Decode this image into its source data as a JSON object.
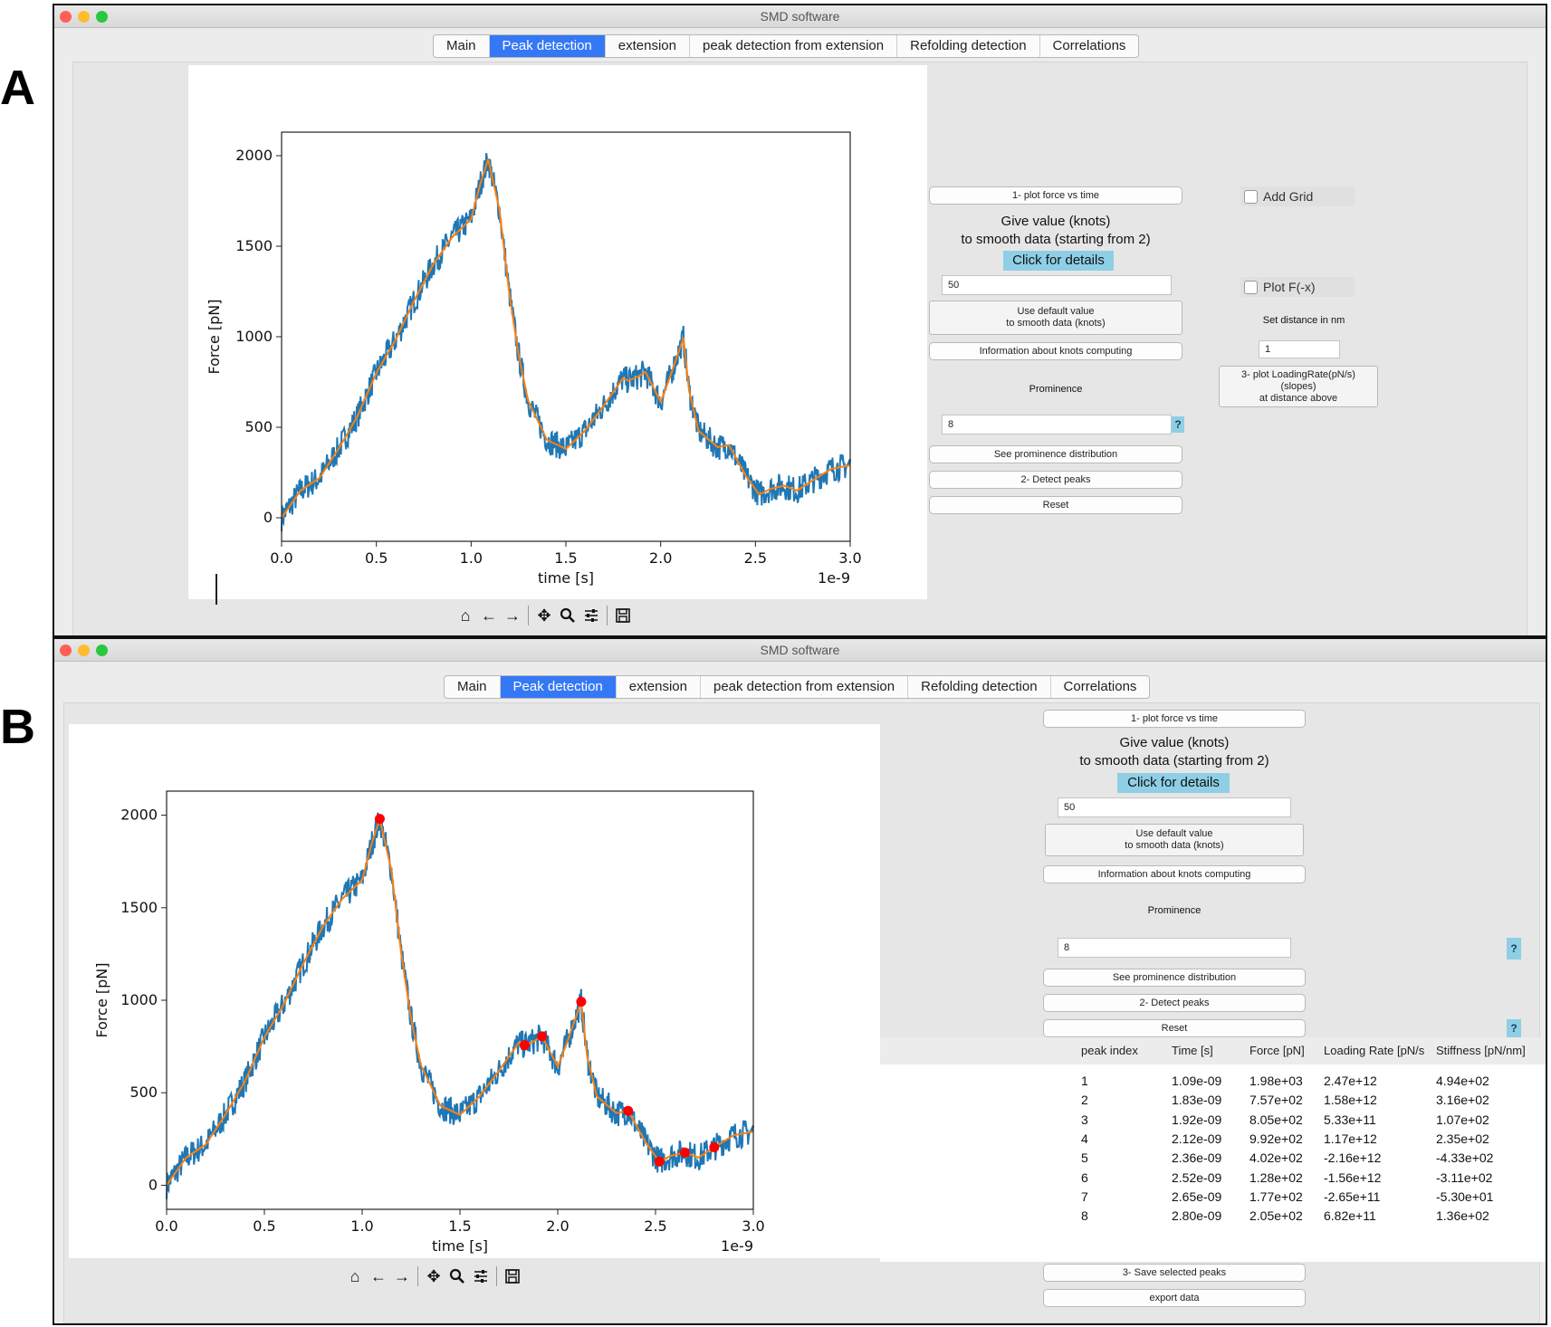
{
  "panels": [
    "A",
    "B"
  ],
  "window": {
    "title": "SMD software"
  },
  "tabs": [
    "Main",
    "Peak detection",
    "extension",
    "peak detection from extension",
    "Refolding detection",
    "Correlations"
  ],
  "controls": {
    "plot_force_btn": "1- plot force vs time",
    "smooth_prompt_1": "Give value (knots)",
    "smooth_prompt_2": "to smooth data (starting from 2)",
    "details_btn": "Click for details",
    "knots_value": "50",
    "default_btn_1": "Use default value",
    "default_btn_2": "to smooth data (knots)",
    "info_btn": "Information about knots computing",
    "prominence_label": "Prominence",
    "prominence_value": "8",
    "help_btn": "?",
    "prominence_dist_btn": "See prominence distribution",
    "detect_btn": "2- Detect peaks",
    "reset_btn": "Reset",
    "add_grid": "Add Grid",
    "plot_fx": "Plot F(-x)",
    "distance_label": "Set distance in nm",
    "distance_value": "1",
    "loading_btn_1": "3- plot LoadingRate(pN/s)",
    "loading_btn_2": "(slopes)",
    "loading_btn_3": "at distance above",
    "save_btn": "3- Save selected peaks",
    "export_btn": "export data"
  },
  "toolbar_icons": [
    "home-icon",
    "back-arrow-icon",
    "forward-arrow-icon",
    "pan-icon",
    "zoom-icon",
    "subplots-icon",
    "save-icon"
  ],
  "chart_data": [
    {
      "type": "line",
      "xlabel": "time [s]",
      "ylabel": "Force [pN]",
      "x_offset_label": "1e-9",
      "xlim": [
        0.0,
        3.0
      ],
      "ylim": [
        -130,
        2130
      ],
      "xticks": [
        "0.0",
        "0.5",
        "1.0",
        "1.5",
        "2.0",
        "2.5",
        "3.0"
      ],
      "yticks": [
        "0",
        "500",
        "1000",
        "1500",
        "2000"
      ],
      "series": [
        {
          "color": "#1f77b4",
          "x": [
            0.0,
            0.1,
            0.2,
            0.3,
            0.4,
            0.5,
            0.6,
            0.7,
            0.8,
            0.9,
            1.0,
            1.05,
            1.09,
            1.15,
            1.2,
            1.25,
            1.3,
            1.4,
            1.5,
            1.6,
            1.7,
            1.8,
            1.83,
            1.88,
            1.92,
            2.0,
            2.05,
            2.12,
            2.15,
            2.2,
            2.3,
            2.36,
            2.45,
            2.52,
            2.58,
            2.65,
            2.72,
            2.8,
            2.9,
            3.0
          ],
          "y": [
            0,
            150,
            220,
            380,
            560,
            800,
            980,
            1200,
            1400,
            1550,
            1650,
            1850,
            1980,
            1700,
            1250,
            900,
            650,
            430,
            380,
            480,
            620,
            770,
            757,
            780,
            805,
            640,
            780,
            992,
            700,
            480,
            390,
            402,
            230,
            128,
            160,
            177,
            150,
            205,
            270,
            290
          ]
        },
        {
          "color": "#ff7f0e",
          "x": [
            0.0,
            0.1,
            0.2,
            0.3,
            0.4,
            0.5,
            0.6,
            0.7,
            0.8,
            0.9,
            1.0,
            1.05,
            1.09,
            1.15,
            1.2,
            1.25,
            1.3,
            1.4,
            1.5,
            1.6,
            1.7,
            1.8,
            1.83,
            1.88,
            1.92,
            2.0,
            2.05,
            2.12,
            2.15,
            2.2,
            2.3,
            2.36,
            2.45,
            2.52,
            2.58,
            2.65,
            2.72,
            2.8,
            2.9,
            3.0
          ],
          "y": [
            0,
            150,
            220,
            380,
            560,
            800,
            980,
            1200,
            1400,
            1550,
            1650,
            1850,
            1980,
            1700,
            1250,
            900,
            650,
            430,
            380,
            480,
            620,
            770,
            757,
            780,
            805,
            640,
            780,
            992,
            700,
            480,
            390,
            402,
            230,
            128,
            160,
            177,
            150,
            205,
            270,
            290
          ]
        }
      ]
    },
    {
      "type": "line",
      "xlabel": "time [s]",
      "ylabel": "Force [pN]",
      "x_offset_label": "1e-9",
      "xlim": [
        0.0,
        3.0
      ],
      "ylim": [
        -130,
        2130
      ],
      "xticks": [
        "0.0",
        "0.5",
        "1.0",
        "1.5",
        "2.0",
        "2.5",
        "3.0"
      ],
      "yticks": [
        "0",
        "500",
        "1000",
        "1500",
        "2000"
      ],
      "series": [
        {
          "color": "#1f77b4",
          "x": [
            0.0,
            0.1,
            0.2,
            0.3,
            0.4,
            0.5,
            0.6,
            0.7,
            0.8,
            0.9,
            1.0,
            1.05,
            1.09,
            1.15,
            1.2,
            1.25,
            1.3,
            1.4,
            1.5,
            1.6,
            1.7,
            1.8,
            1.83,
            1.88,
            1.92,
            2.0,
            2.05,
            2.12,
            2.15,
            2.2,
            2.3,
            2.36,
            2.45,
            2.52,
            2.58,
            2.65,
            2.72,
            2.8,
            2.9,
            3.0
          ],
          "y": [
            0,
            150,
            220,
            380,
            560,
            800,
            980,
            1200,
            1400,
            1550,
            1650,
            1850,
            1980,
            1700,
            1250,
            900,
            650,
            430,
            380,
            480,
            620,
            770,
            757,
            780,
            805,
            640,
            780,
            992,
            700,
            480,
            390,
            402,
            230,
            128,
            160,
            177,
            150,
            205,
            270,
            290
          ]
        },
        {
          "color": "#ff7f0e",
          "x": [
            0.0,
            0.1,
            0.2,
            0.3,
            0.4,
            0.5,
            0.6,
            0.7,
            0.8,
            0.9,
            1.0,
            1.05,
            1.09,
            1.15,
            1.2,
            1.25,
            1.3,
            1.4,
            1.5,
            1.6,
            1.7,
            1.8,
            1.83,
            1.88,
            1.92,
            2.0,
            2.05,
            2.12,
            2.15,
            2.2,
            2.3,
            2.36,
            2.45,
            2.52,
            2.58,
            2.65,
            2.72,
            2.8,
            2.9,
            3.0
          ],
          "y": [
            0,
            150,
            220,
            380,
            560,
            800,
            980,
            1200,
            1400,
            1550,
            1650,
            1850,
            1980,
            1700,
            1250,
            900,
            650,
            430,
            380,
            480,
            620,
            770,
            757,
            780,
            805,
            640,
            780,
            992,
            700,
            480,
            390,
            402,
            230,
            128,
            160,
            177,
            150,
            205,
            270,
            290
          ]
        }
      ],
      "peaks": {
        "color": "#ff0000",
        "x": [
          1.09,
          1.83,
          1.92,
          2.12,
          2.36,
          2.52,
          2.65,
          2.8
        ],
        "y": [
          1980,
          757,
          805,
          992,
          402,
          128,
          177,
          205
        ]
      }
    }
  ],
  "table": {
    "headers": [
      "peak index",
      "Time [s]",
      "Force [pN]",
      "Loading Rate [pN/s",
      "Stiffness [pN/nm]"
    ],
    "rows": [
      [
        "1",
        "1.09e-09",
        "1.98e+03",
        "2.47e+12",
        "4.94e+02"
      ],
      [
        "2",
        "1.83e-09",
        "7.57e+02",
        "1.58e+12",
        "3.16e+02"
      ],
      [
        "3",
        "1.92e-09",
        "8.05e+02",
        "5.33e+11",
        "1.07e+02"
      ],
      [
        "4",
        "2.12e-09",
        "9.92e+02",
        "1.17e+12",
        "2.35e+02"
      ],
      [
        "5",
        "2.36e-09",
        "4.02e+02",
        "-2.16e+12",
        "-4.33e+02"
      ],
      [
        "6",
        "2.52e-09",
        "1.28e+02",
        "-1.56e+12",
        "-3.11e+02"
      ],
      [
        "7",
        "2.65e-09",
        "1.77e+02",
        "-2.65e+11",
        "-5.30e+01"
      ],
      [
        "8",
        "2.80e-09",
        "2.05e+02",
        "6.82e+11",
        "1.36e+02"
      ]
    ]
  }
}
